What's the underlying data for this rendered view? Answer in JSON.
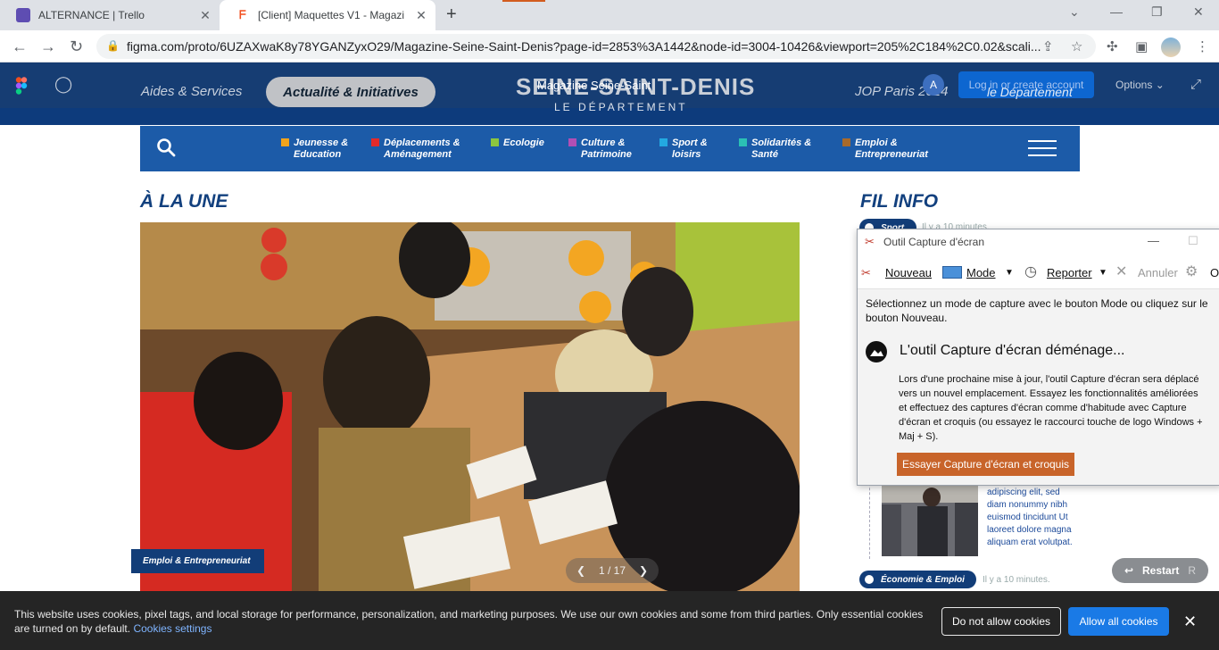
{
  "browser": {
    "tabs": [
      {
        "title": "ALTERNANCE | Trello",
        "favicon_color": "#5e4db2"
      },
      {
        "title": "[Client] Maquettes V1 - Magazi",
        "favicon_color": "#f24e1e"
      }
    ],
    "url": "figma.com/proto/6UZAXwaK8y78YGANZyxO29/Magazine-Seine-Saint-Denis?page-id=2853%3A1442&node-id=3004-10426&viewport=205%2C184%2C0.02&scali..."
  },
  "figma": {
    "nav_left": [
      "Aides & Services",
      "Actualité & Initiatives"
    ],
    "logo_main": "SEINE-SAINT-DENIS",
    "logo_sub": "LE DÉPARTEMENT",
    "logo_overlay": "Magazine Seine-Saint",
    "nav_right_link": "JOP Paris 2024",
    "login_label": "Log in or create account",
    "login_overlay": "le Département",
    "avatar_letter": "A",
    "options_label": "Options ⌄"
  },
  "nav": {
    "items": [
      {
        "label_1": "Jeunesse &",
        "label_2": "Education",
        "color": "#f2a31b"
      },
      {
        "label_1": "Déplacements &",
        "label_2": "Aménagement",
        "color": "#e32a2a"
      },
      {
        "label_1": "Ecologie",
        "label_2": "",
        "color": "#8cc63f"
      },
      {
        "label_1": "Culture &",
        "label_2": "Patrimoine",
        "color": "#b24fb4"
      },
      {
        "label_1": "Sport &",
        "label_2": "loisirs",
        "color": "#23a9e1"
      },
      {
        "label_1": "Solidarités &",
        "label_2": "Santé",
        "color": "#2bc0b4"
      },
      {
        "label_1": "Emploi &",
        "label_2": "Entrepreneuriat",
        "color": "#a86a2b"
      }
    ]
  },
  "main": {
    "une_title": "À LA UNE",
    "hero_category": "Emploi & Entrepreneuriat",
    "hero_page": "1 / 17"
  },
  "fil": {
    "title": "FIL INFO",
    "badge_top": "Sport",
    "ago_top": "Il y a 10 minutes.",
    "news_text": "adipiscing elit, sed diam nonummy nibh euismod tincidunt Ut laoreet dolore magna aliquam erat volutpat.",
    "badge_bottom": "Économie & Emploi",
    "ago_bottom": "Il y a 10 minutes."
  },
  "restart": {
    "label": "Restart",
    "key": "R"
  },
  "snip": {
    "title": "Outil Capture d'écran",
    "tools": {
      "new": "Nouveau",
      "mode": "Mode",
      "delay": "Reporter",
      "cancel": "Annuler",
      "options": "O"
    },
    "message": "Sélectionnez un mode de capture avec le bouton Mode ou cliquez sur le bouton Nouveau.",
    "heading": "L'outil Capture d'écran déménage...",
    "body": "Lors d'une prochaine mise à jour, l'outil Capture d'écran sera déplacé vers un nouvel emplacement. Essayez les fonctionnalités améliorées et effectuez des captures d'écran comme d'habitude avec Capture d'écran et croquis (ou essayez le raccourci touche de logo Windows + Maj + S).",
    "button": "Essayer Capture d'écran et croquis"
  },
  "cookie": {
    "text": "This website uses cookies, pixel tags, and local storage for performance, personalization, and marketing purposes. We use our own cookies and some from third parties. Only essential cookies are turned on by default.",
    "link": "Cookies settings",
    "deny": "Do not allow cookies",
    "allow": "Allow all cookies"
  }
}
